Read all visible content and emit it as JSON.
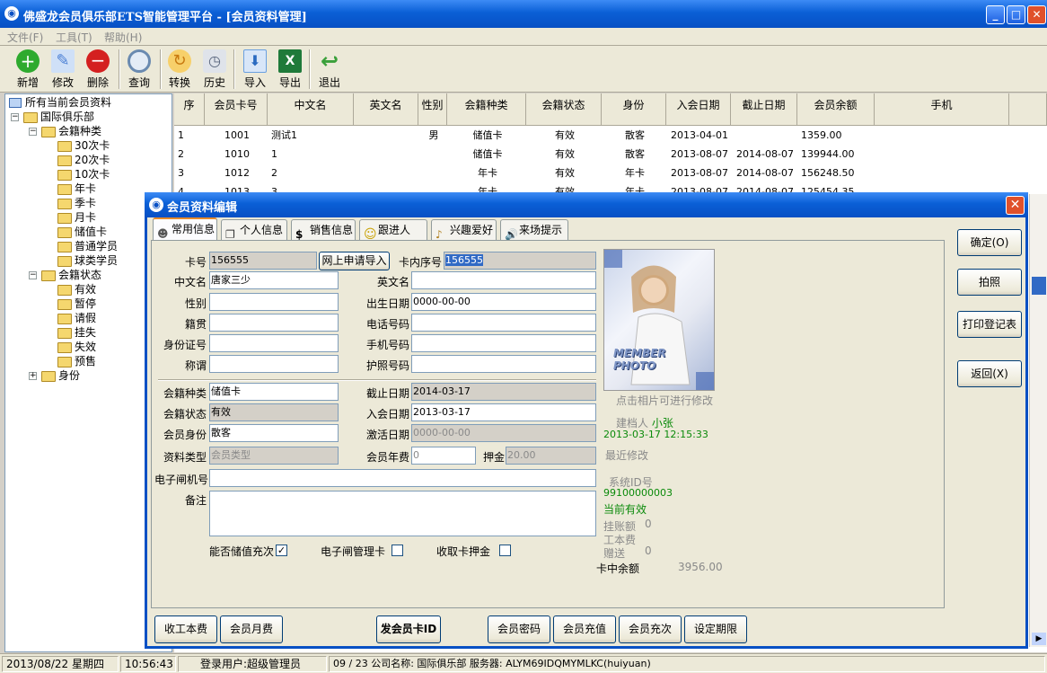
{
  "window": {
    "title": "佛盛龙会员俱乐部ETS智能管理平台 - [会员资料管理]",
    "icon": "app-logo-icon"
  },
  "menu": [
    {
      "label": "文件(F)"
    },
    {
      "label": "工具(T)"
    },
    {
      "label": "帮助(H)"
    }
  ],
  "toolbar": [
    {
      "label": "新增",
      "icon": "add-icon",
      "color": "#2eaa2e"
    },
    {
      "label": "修改",
      "icon": "edit-icon",
      "color": "#4a7fd4"
    },
    {
      "label": "删除",
      "icon": "delete-icon",
      "color": "#d42020"
    },
    {
      "label": "查询",
      "icon": "search-icon",
      "color": "#6a8ab0"
    },
    {
      "label": "转换",
      "icon": "convert-icon",
      "color": "#e8a020"
    },
    {
      "label": "历史",
      "icon": "history-icon",
      "color": "#7a8aa0"
    },
    {
      "label": "导入",
      "icon": "import-icon",
      "color": "#6aa0e0"
    },
    {
      "label": "导出",
      "icon": "export-excel-icon",
      "color": "#1f7a3a"
    },
    {
      "label": "退出",
      "icon": "exit-icon",
      "color": "#3aa03a"
    }
  ],
  "tree": {
    "root": "所有当前会员资料",
    "club": "国际俱乐部",
    "type_group": "会籍种类",
    "types": [
      "30次卡",
      "20次卡",
      "10次卡",
      "年卡",
      "季卡",
      "月卡",
      "储值卡",
      "普通学员",
      "球类学员"
    ],
    "status_group": "会籍状态",
    "statuses": [
      "有效",
      "暂停",
      "请假",
      "挂失",
      "失效",
      "预售"
    ],
    "identity_group": "身份"
  },
  "grid": {
    "headers": [
      "序",
      "会员卡号",
      "中文名",
      "英文名",
      "性别",
      "会籍种类",
      "会籍状态",
      "身份",
      "入会日期",
      "截止日期",
      "会员余额",
      "手机"
    ],
    "rows": [
      [
        "1",
        "1001",
        "测试1",
        "",
        "男",
        "储值卡",
        "有效",
        "散客",
        "2013-04-01",
        "",
        "1359.00",
        ""
      ],
      [
        "2",
        "1010",
        "1",
        "",
        "",
        "储值卡",
        "有效",
        "散客",
        "2013-08-07",
        "2014-08-07",
        "139944.00",
        ""
      ],
      [
        "3",
        "1012",
        "2",
        "",
        "",
        "年卡",
        "有效",
        "年卡",
        "2013-08-07",
        "2014-08-07",
        "156248.50",
        ""
      ],
      [
        "4",
        "1013",
        "3",
        "",
        "",
        "年卡",
        "有效",
        "年卡",
        "2013-08-07",
        "2014-08-07",
        "125454.35",
        ""
      ]
    ]
  },
  "dialog": {
    "title": "会员资料编辑",
    "tabs": [
      "常用信息",
      "个人信息",
      "销售信息",
      "跟进人",
      "兴趣爱好",
      "来场提示"
    ],
    "fields": {
      "card_no": {
        "label": "卡号",
        "value": "156555"
      },
      "import_btn": "网上申请导入",
      "inner_no": {
        "label": "卡内序号",
        "value": "156555"
      },
      "cn_name": {
        "label": "中文名",
        "value": "唐家三少"
      },
      "en_name": {
        "label": "英文名",
        "value": ""
      },
      "gender": {
        "label": "性别",
        "value": ""
      },
      "birth": {
        "label": "出生日期",
        "value": "0000-00-00"
      },
      "native": {
        "label": "籍贯",
        "value": ""
      },
      "phone": {
        "label": "电话号码",
        "value": ""
      },
      "id_no": {
        "label": "身份证号",
        "value": ""
      },
      "mobile": {
        "label": "手机号码",
        "value": ""
      },
      "title": {
        "label": "称谓",
        "value": ""
      },
      "passport": {
        "label": "护照号码",
        "value": ""
      },
      "mem_type": {
        "label": "会籍种类",
        "value": "储值卡"
      },
      "end_date": {
        "label": "截止日期",
        "value": "2014-03-17"
      },
      "mem_status": {
        "label": "会籍状态",
        "value": "有效"
      },
      "join_date": {
        "label": "入会日期",
        "value": "2013-03-17"
      },
      "mem_identity": {
        "label": "会员身份",
        "value": "散客"
      },
      "act_date": {
        "label": "激活日期",
        "value": "0000-00-00"
      },
      "data_type": {
        "label": "资料类型",
        "value": "会员类型"
      },
      "annual_fee": {
        "label": "会员年费",
        "value": "0"
      },
      "deposit": {
        "label": "押金",
        "value": "20.00"
      },
      "gate_no": {
        "label": "电子闸机号",
        "value": ""
      },
      "remark": {
        "label": "备注",
        "value": ""
      }
    },
    "checks": [
      {
        "label": "能否储值充次",
        "checked": true,
        "mark": "✓"
      },
      {
        "label": "电子闸管理卡",
        "checked": false,
        "mark": ""
      },
      {
        "label": "收取卡押金",
        "checked": false,
        "mark": ""
      }
    ],
    "photo": {
      "text": "MEMBER PHOTO",
      "hint": "点击相片可进行修改"
    },
    "info": {
      "creator_label": "建档人",
      "creator": "小张",
      "created": "2013-03-17 12:15:33",
      "last_modified": "最近修改",
      "sysid_label": "系统ID号",
      "sysid": "99100000003",
      "current": "当前有效",
      "on_account_label": "挂账额",
      "on_account": "0",
      "cost_label": "工本费",
      "gift_label": "赠送",
      "gift": "0",
      "balance_label": "卡中余额",
      "balance": "3956.00"
    },
    "right_buttons": [
      "确定(O)",
      "拍照",
      "打印登记表",
      "返回(X)"
    ],
    "bottom_buttons": [
      "收工本费",
      "会员月费",
      "发会员卡ID",
      "会员密码",
      "会员充值",
      "会员充次",
      "设定期限"
    ]
  },
  "status": {
    "date": "2013/08/22 星期四",
    "time": "10:56:43",
    "user": "登录用户:超级管理员",
    "info": "09 / 23 公司名称: 国际俱乐部 服务器: ALYM69IDQMYMLKC(huiyuan)"
  }
}
